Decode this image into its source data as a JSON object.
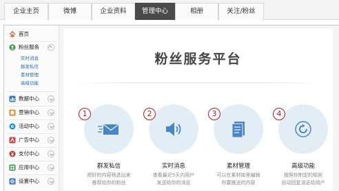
{
  "tabs": [
    {
      "label": "企业主页",
      "active": false
    },
    {
      "label": "微博",
      "active": false
    },
    {
      "label": "企业资料",
      "active": false
    },
    {
      "label": "管理中心",
      "active": true
    },
    {
      "label": "相册",
      "active": false
    },
    {
      "label": "关注/粉丝",
      "active": false
    }
  ],
  "sidebar": {
    "home": {
      "label": "首页",
      "icon": "home-icon"
    },
    "fans": {
      "label": "粉丝服务",
      "icon": "fans-icon",
      "subs": [
        "实时消息",
        "群发私信",
        "素材管理",
        "高级功能"
      ]
    },
    "items": [
      {
        "label": "数据中心",
        "icon": "data-center-icon",
        "color": "#3b78c4"
      },
      {
        "label": "营销中心",
        "icon": "marketing-icon",
        "color": "#e08a2a"
      },
      {
        "label": "活动中心",
        "icon": "activity-icon",
        "color": "#2a8fd0"
      },
      {
        "label": "广告中心",
        "icon": "ads-icon",
        "color": "#d34545"
      },
      {
        "label": "支付中心",
        "icon": "payment-icon",
        "color": "#c6372f"
      },
      {
        "label": "应用中心",
        "icon": "app-icon",
        "color": "#3a9a4a"
      },
      {
        "label": "设置中心",
        "icon": "settings-icon",
        "color": "#3b78c4"
      }
    ]
  },
  "main": {
    "title": "粉丝服务平台",
    "features": [
      {
        "number": "1",
        "title": "群发私信",
        "desc1": "把好的内容筛选出来",
        "desc2": "推荐给你的粉丝",
        "icon": "envelope-icon"
      },
      {
        "number": "2",
        "title": "实时消息",
        "desc1": "查看最近5天内用户",
        "desc2": "发送给你的消息",
        "icon": "speaker-icon"
      },
      {
        "number": "3",
        "title": "素材管理",
        "desc1": "可以在素材库里编辑",
        "desc2": "你要推送的内容",
        "icon": "document-icon"
      },
      {
        "number": "4",
        "title": "高级功能",
        "desc1": "按照你制定的规则",
        "desc2": "自动回复消息给用户",
        "icon": "refresh-icon"
      }
    ]
  },
  "colors": {
    "accent": "#4a4a4a",
    "link": "#2a6fb5",
    "number_badge": "#c01818",
    "feature_circle": "#e2edf6",
    "icon_blue": "#4a86c5"
  }
}
